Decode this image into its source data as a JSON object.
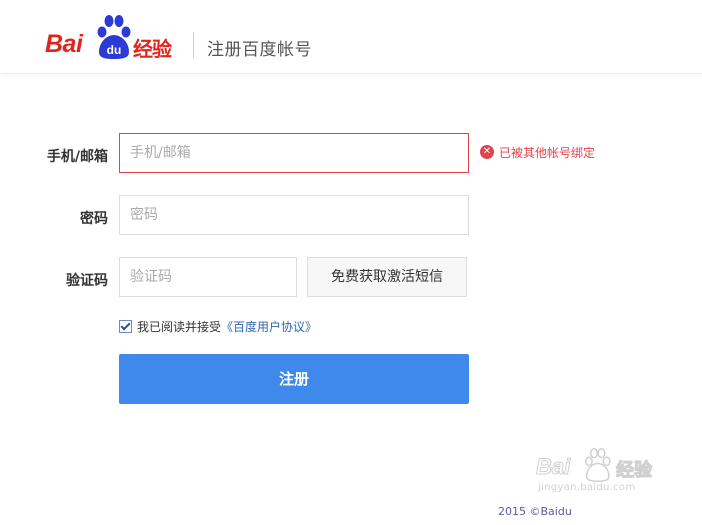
{
  "header": {
    "logo_text": "Bai",
    "logo_paw_text": "du",
    "logo_suffix": "经验",
    "page_title": "注册百度帐号"
  },
  "form": {
    "phone_label": "手机/邮箱",
    "phone_placeholder": "手机/邮箱",
    "phone_error": "已被其他帐号绑定",
    "password_label": "密码",
    "password_placeholder": "密码",
    "captcha_label": "验证码",
    "captcha_placeholder": "验证码",
    "sms_button": "免费获取激活短信",
    "agree_prefix": "我已阅读并接受",
    "agree_link": "《百度用户协议》",
    "agree_checked": true,
    "submit_button": "注册"
  },
  "watermark": {
    "text": "Bai",
    "suffix": "经验",
    "url": "jingyan.baidu.com"
  },
  "footer": {
    "copyright": "2015 ©Baidu"
  },
  "colors": {
    "brand_red": "#e1251b",
    "paw_blue": "#2d3bd6",
    "error_red": "#e2444c",
    "submit_blue": "#3f89ec",
    "link_blue": "#2f66b0"
  }
}
